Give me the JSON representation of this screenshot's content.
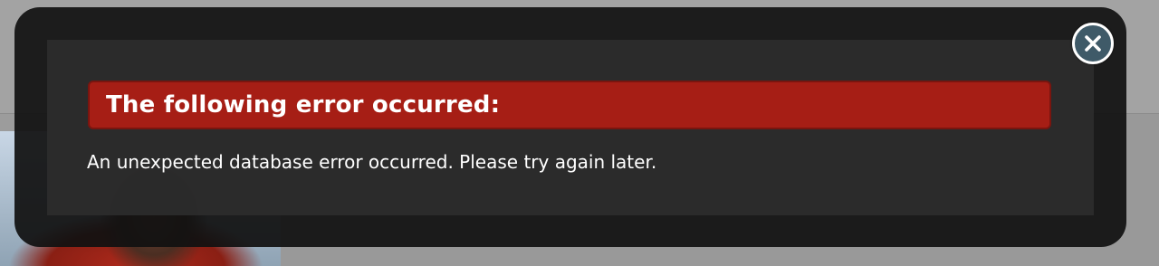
{
  "dialog": {
    "title": "The following error occurred:",
    "message": "An unexpected database error occurred. Please try again later.",
    "close_icon": "close-icon"
  },
  "colors": {
    "error_bar": "#a61e15",
    "modal_background": "#111111",
    "close_button": "#3f5a68"
  }
}
